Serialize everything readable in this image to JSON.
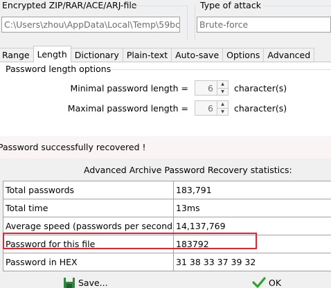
{
  "encrypted_file": {
    "group_label": "Encrypted ZIP/RAR/ACE/ARJ-file",
    "path": "C:\\Users\\zhou\\AppData\\Local\\Temp\\59bc"
  },
  "attack": {
    "group_label": "Type of attack",
    "value": "Brute-force"
  },
  "tabs": [
    {
      "label": "Range"
    },
    {
      "label": "Length"
    },
    {
      "label": "Dictionary"
    },
    {
      "label": "Plain-text"
    },
    {
      "label": "Auto-save"
    },
    {
      "label": "Options"
    },
    {
      "label": "Advanced"
    }
  ],
  "length_options": {
    "group_label": "Password length options",
    "min_label": "Minimal password length =",
    "min_value": "6",
    "max_label": "Maximal password length =",
    "max_value": "6",
    "unit": "character(s)"
  },
  "dialog": {
    "message": "Password successfully recovered !",
    "stats_title": "Advanced Archive Password Recovery statistics:",
    "rows": [
      {
        "label": "Total passwords",
        "value": "183,791"
      },
      {
        "label": "Total time",
        "value": "13ms"
      },
      {
        "label": "Average speed (passwords per second)",
        "value": "14,137,769"
      },
      {
        "label": "Password for this file",
        "value": "183792"
      },
      {
        "label": "Password in HEX",
        "value": "31 38 33 37 39 32"
      }
    ],
    "save_label": "Save...",
    "ok_label": "OK"
  },
  "colors": {
    "highlight": "#e8212d",
    "ok_check": "#2aa52a",
    "save_icon": "#2c8a3c"
  }
}
